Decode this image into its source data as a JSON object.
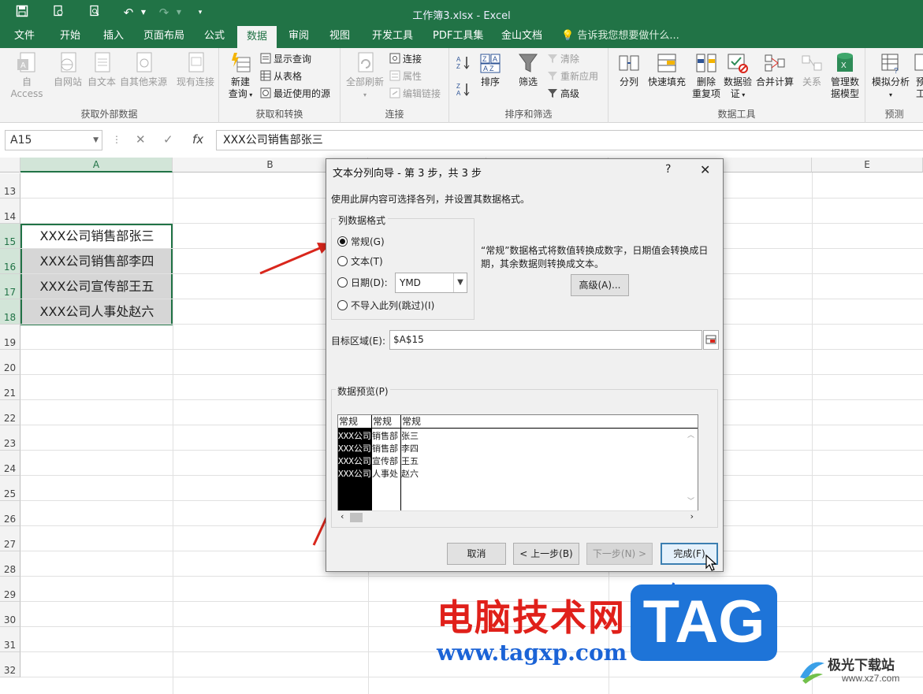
{
  "window": {
    "title": "工作簿3.xlsx - Excel"
  },
  "quick_access": [
    "save-icon",
    "print-preview-icon",
    "undo-icon",
    "redo-icon",
    "customize-icon"
  ],
  "tabs": [
    "文件",
    "开始",
    "插入",
    "页面布局",
    "公式",
    "数据",
    "审阅",
    "视图",
    "开发工具",
    "PDF工具集",
    "金山文档"
  ],
  "active_tab": "数据",
  "tell_me": "告诉我您想要做什么...",
  "ribbon": {
    "groups": [
      {
        "label": "获取外部数据",
        "buttons": [
          "自 Access",
          "自网站",
          "自文本",
          "自其他来源",
          "现有连接"
        ]
      },
      {
        "label": "获取和转换",
        "big": [
          "新建",
          "查询"
        ],
        "small": [
          "显示查询",
          "从表格",
          "最近使用的源"
        ]
      },
      {
        "label": "连接",
        "big": [
          "全部刷新"
        ],
        "small": [
          "连接",
          "属性",
          "编辑链接"
        ]
      },
      {
        "label": "排序和筛选",
        "big": [
          "排序",
          "筛选"
        ],
        "small": [
          "清除",
          "重新应用",
          "高级"
        ]
      },
      {
        "label": "数据工具",
        "buttons": [
          "分列",
          "快速填充",
          "删除重复项",
          "数据验证",
          "合并计算",
          "关系",
          "管理数据模型"
        ]
      },
      {
        "label": "预测",
        "buttons": [
          "模拟分析",
          "预"
        ]
      }
    ],
    "delete_dup": [
      "删除",
      "重复项"
    ],
    "validate": [
      "数据验",
      "证"
    ],
    "model": [
      "管理数",
      "据模型"
    ],
    "last": "工"
  },
  "formula_bar": {
    "name_box": "A15",
    "fx": "fx",
    "content": "XXX公司销售部张三"
  },
  "columns": [
    "A",
    "B",
    "E"
  ],
  "rows": [
    "13",
    "14",
    "15",
    "16",
    "17",
    "18",
    "19",
    "20",
    "21",
    "22",
    "23",
    "24",
    "25",
    "26",
    "27",
    "28",
    "29",
    "30",
    "31",
    "32"
  ],
  "cells": [
    "XXX公司销售部张三",
    "XXX公司销售部李四",
    "XXX公司宣传部王五",
    "XXX公司人事处赵六"
  ],
  "dialog": {
    "title": "文本分列向导 - 第 3 步，共 3 步",
    "help": "?",
    "instruction": "使用此屏内容可选择各列，并设置其数据格式。",
    "format_group": "列数据格式",
    "options": [
      "常规(G)",
      "文本(T)",
      "日期(D):",
      "不导入此列(跳过)(I)"
    ],
    "selected_option": "常规(G)",
    "date_format": "YMD",
    "description": "“常规”数据格式将数值转换成数字，日期值会转换成日期，其余数据则转换成文本。",
    "advanced_button": "高级(A)...",
    "target_label": "目标区域(E):",
    "target_value": "$A$15",
    "preview_label": "数据预览(P)",
    "preview_headers": [
      "常规",
      "常规",
      "常规"
    ],
    "preview_rows": [
      [
        "XXX公司",
        "销售部",
        "张三"
      ],
      [
        "XXX公司",
        "销售部",
        "李四"
      ],
      [
        "XXX公司",
        "宣传部",
        "王五"
      ],
      [
        "XXX公司",
        "人事处",
        "赵六"
      ]
    ],
    "buttons": {
      "cancel": "取消",
      "back": "< 上一步(B)",
      "next": "下一步(N) >",
      "finish": "完成(F)"
    }
  },
  "watermark": {
    "cn": "电脑技术网",
    "url": "www.tagxp.com",
    "tag": "TAG",
    "corner": "极光下载站",
    "corner_url": "www.xz7.com"
  },
  "colors": {
    "excel_green": "#217346",
    "arrow_red": "#d9261c",
    "watermark_red": "#e0201a",
    "watermark_blue": "#1b63d6",
    "tag_blue": "#1e74d8"
  }
}
